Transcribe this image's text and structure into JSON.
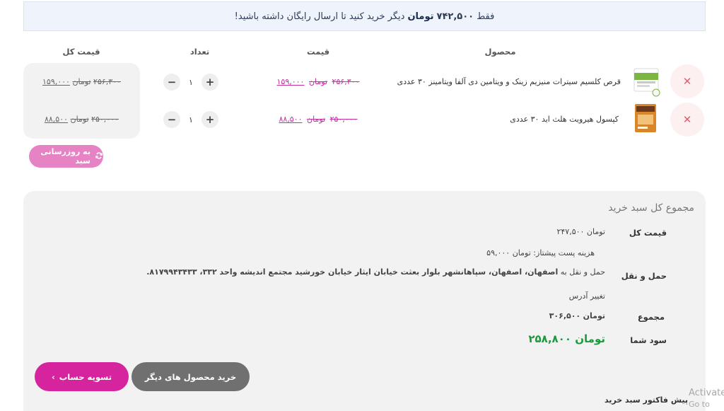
{
  "notice": {
    "prefix": "فقط",
    "amount": "۷۴۲,۵۰۰",
    "unit": "تومان",
    "suffix": "دیگر خرید کنید تا ارسال رایگان داشته باشید!"
  },
  "table": {
    "headers": {
      "product": "محصول",
      "price": "قیمت",
      "quantity": "تعداد",
      "total": "قیمت کل"
    },
    "rows": [
      {
        "name": "قرص کلسیم سیترات منیزیم زینک و ویتامین دی آلفا ویتامینز ۳۰ عددی",
        "old_price": "۲۵۶,۳۰۰",
        "new_price": "۱۵۹,۰۰۰",
        "currency": "تومان",
        "quantity": "۱",
        "total_old": "۲۵۶,۳۰۰",
        "total_new": "۱۵۹,۰۰۰"
      },
      {
        "name": "کپسول هیرویت هلث اید ۳۰ عددی",
        "old_price": "۲۵۰,۰۰۰",
        "new_price": "۸۸,۵۰۰",
        "currency": "تومان",
        "quantity": "۱",
        "total_old": "۲۵۰,۰۰۰",
        "total_new": "۸۸,۵۰۰"
      }
    ],
    "remove_icon": "close-icon",
    "plus": "+",
    "minus": "−"
  },
  "update_cart": {
    "label": "به روزرسانی سبد",
    "icon": "refresh-icon"
  },
  "summary": {
    "title": "مجموع کل سبد خرید",
    "subtotal_label": "قیمت کل",
    "subtotal_value": "۲۴۷,۵۰۰",
    "currency": "تومان",
    "shipping_label": "حمل و نقل",
    "shipping_cost_text": "هزینه پست پیشتاز:",
    "shipping_cost_value": "۵۹,۰۰۰",
    "shipping_to_prefix": "حمل و نقل به",
    "shipping_address": "اصفهان، اصفهان، سپاهانشهر بلوار بعثت خیابان ایثار خیابان خورشید مجتمع اندیشه واحد ۳۳۲، ۸۱۷۹۹۴۳۴۳۳.",
    "change_address": "تغییر آدرس",
    "total_label": "مجموع",
    "total_value": "۳۰۶,۵۰۰",
    "profit_label": "سود شما",
    "profit_value": "۲۵۸,۸۰۰"
  },
  "buttons": {
    "checkout": "تسویه حساب",
    "continue_shopping": "خرید محصول های دیگر"
  },
  "invoice_label": "پیش فاکتور سبد خرید",
  "watermark": {
    "line1": "Activate",
    "line2": "Go to Setti"
  },
  "colors": {
    "accent": "#d6249f",
    "accent_light": "#e683c5",
    "profit": "#1a9a3b",
    "remove": "#e65b6a",
    "notice_bg": "#eef3fc"
  }
}
